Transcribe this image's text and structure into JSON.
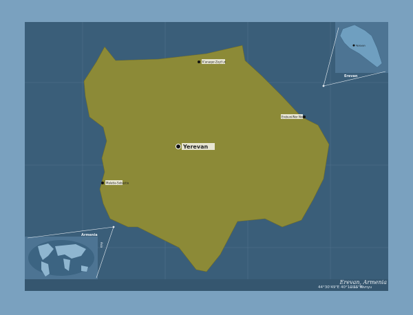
{
  "map": {
    "region_name": "Yerevan",
    "country_title": "Erevan, Armenia",
    "coordinates_text": "44°30'49\"E  40°10'55\"N",
    "scale_label": "Rivnyu",
    "credit_text": "",
    "colors": {
      "background": "#7aa1bf",
      "map_frame": "#3a5e79",
      "region_fill": "#8c8a37",
      "inset_fill": "#6f9fc0",
      "inset_dark": "#3c6482"
    }
  },
  "places": {
    "capital": "Yerevan",
    "top": "K'anaqer-Zeyt'un",
    "right": "Erebuni/Nor Nork",
    "left": "Malatia-Sebastia"
  },
  "inset_country": {
    "label": "Erevan",
    "marker_label": "Yerevan"
  },
  "inset_world": {
    "label": "Armenia",
    "side_label": "Asia"
  }
}
